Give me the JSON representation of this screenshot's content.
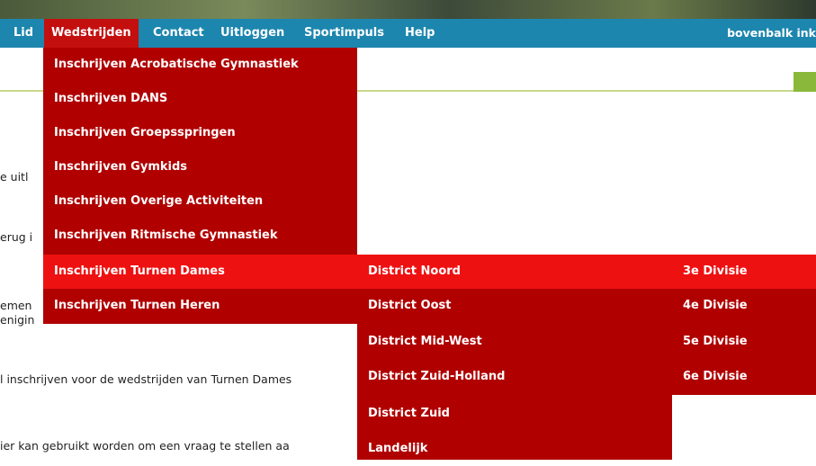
{
  "nav": {
    "items": [
      {
        "label": "Lid"
      },
      {
        "label": "Wedstrijden"
      },
      {
        "label": "Contact"
      },
      {
        "label": "Uitloggen"
      },
      {
        "label": "Sportimpuls"
      },
      {
        "label": "Help"
      }
    ],
    "right_link": "bovenbalk ink"
  },
  "page": {
    "fragments": [
      "e uitl",
      "erug i",
      "emen",
      "enigin",
      "l inschrijven voor de wedstrijden van Turnen Dames",
      "ier kan gebruikt worden om een vraag te stellen aa"
    ]
  },
  "menus": {
    "wedstrijden": [
      "Inschrijven Acrobatische Gymnastiek",
      "Inschrijven DANS",
      "Inschrijven Groepsspringen",
      "Inschrijven Gymkids",
      "Inschrijven Overige Activiteiten",
      "Inschrijven Ritmische Gymnastiek",
      "Inschrijven Turnen Dames",
      "Inschrijven Turnen Heren"
    ],
    "districts": [
      "District Noord",
      "District Oost",
      "District Mid-West",
      "District Zuid-Holland",
      "District Zuid",
      "Landelijk"
    ],
    "divisies": [
      "3e Divisie",
      "4e Divisie",
      "5e Divisie",
      "6e Divisie"
    ]
  },
  "colors": {
    "navbar": "#1d86ae",
    "menu": "#b00000",
    "menu_highlight": "#ee1111",
    "accent_green": "#8ab83a"
  }
}
